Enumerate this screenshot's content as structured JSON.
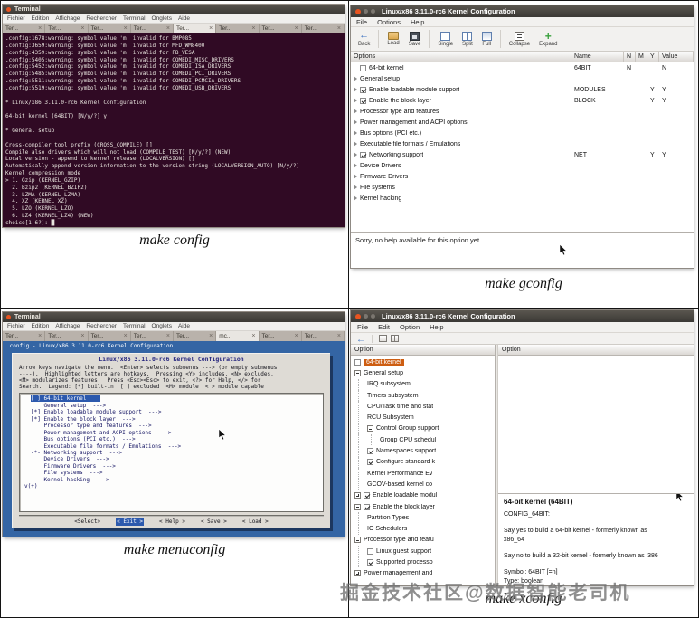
{
  "captions": {
    "tl": "make config",
    "tr": "make gconfig",
    "bl": "make menuconfig",
    "br": "make xconfig"
  },
  "watermark": "掘金技术社区@数据智能老司机",
  "terminal_chrome": {
    "title": "Terminal",
    "menu": [
      "Fichier",
      "Edition",
      "Affichage",
      "Rechercher",
      "Terminal",
      "Onglets",
      "Aide"
    ]
  },
  "config_terminal": {
    "tabs": [
      "Ter...",
      "Ter...",
      "Ter...",
      "Ter...",
      "Ter...",
      "Ter...",
      "Ter...",
      "Ter..."
    ],
    "active_tab": 4,
    "lines": [
      ".config:1678:warning: symbol value 'm' invalid for BMP085",
      ".config:3659:warning: symbol value 'm' invalid for MFD_WM8400",
      ".config:4359:warning: symbol value 'm' invalid for FB_VESA",
      ".config:5405:warning: symbol value 'm' invalid for COMEDI_MISC_DRIVERS",
      ".config:5452:warning: symbol value 'm' invalid for COMEDI_ISA_DRIVERS",
      ".config:5485:warning: symbol value 'm' invalid for COMEDI_PCI_DRIVERS",
      ".config:5511:warning: symbol value 'm' invalid for COMEDI_PCMCIA_DRIVERS",
      ".config:5519:warning: symbol value 'm' invalid for COMEDI_USB_DRIVERS",
      "",
      "* Linux/x86 3.11.0-rc6 Kernel Configuration",
      "",
      "64-bit kernel (64BIT) [N/y/?] y",
      "",
      "* General setup",
      "",
      "Cross-compiler tool prefix (CROSS_COMPILE) []",
      "Compile also drivers which will not load (COMPILE_TEST) [N/y/?] (NEW)",
      "Local version - append to kernel release (LOCALVERSION) []",
      "Automatically append version information to the version string (LOCALVERSION_AUTO) [N/y/?]",
      "Kernel compression mode",
      "> 1. Gzip (KERNEL_GZIP)",
      "  2. Bzip2 (KERNEL_BZIP2)",
      "  3. LZMA (KERNEL_LZMA)",
      "  4. XZ (KERNEL_XZ)",
      "  5. LZO (KERNEL_LZO)",
      "  6. LZ4 (KERNEL_LZ4) (NEW)",
      "choice[1-6?]: █"
    ]
  },
  "menuconfig_terminal": {
    "tabs": [
      "Ter...",
      "Ter...",
      "Ter...",
      "Ter...",
      "Ter...",
      "mc...",
      "Ter...",
      "Ter..."
    ],
    "active_tab": 5,
    "backtitle": ".config - Linux/x86 3.11.0-rc6 Kernel Configuration",
    "dialog_title": "Linux/x86 3.11.0-rc6 Kernel Configuration",
    "instructions": [
      "Arrow keys navigate the menu.  <Enter> selects submenus ---> (or empty submenus",
      "----).  Highlighted letters are hotkeys.  Pressing <Y> includes, <N> excludes,",
      "<M> modularizes features.  Press <Esc><Esc> to exit, <?> for Help, </> for",
      "Search.  Legend: [*] built-in  [ ] excluded  <M> module  < > module capable"
    ],
    "items": [
      {
        "label": "[ ] 64-bit kernel",
        "selected": true
      },
      {
        "label": "    General setup  --->"
      },
      {
        "label": "[*] Enable loadable module support  --->"
      },
      {
        "label": "[*] Enable the block layer  --->"
      },
      {
        "label": "    Processor type and features  --->"
      },
      {
        "label": "    Power management and ACPI options  --->"
      },
      {
        "label": "    Bus options (PCI etc.)  --->"
      },
      {
        "label": "    Executable file formats / Emulations  --->"
      },
      {
        "label": "-*- Networking support  --->"
      },
      {
        "label": "    Device Drivers  --->"
      },
      {
        "label": "    Firmware Drivers  --->"
      },
      {
        "label": "    File systems  --->"
      },
      {
        "label": "    Kernel hacking  --->"
      }
    ],
    "scroll_hint": "v(+)",
    "buttons": [
      {
        "label": "<Select>"
      },
      {
        "label": "< Exit >",
        "selected": true
      },
      {
        "label": "< Help >"
      },
      {
        "label": "< Save >"
      },
      {
        "label": "< Load >"
      }
    ]
  },
  "gconfig": {
    "title": "Linux/x86 3.11.0-rc6 Kernel Configuration",
    "menu": [
      "File",
      "Options",
      "Help"
    ],
    "toolbar": [
      {
        "label": "Back",
        "icon": "back-arrow"
      },
      {
        "sep": true
      },
      {
        "label": "Load",
        "icon": "folder"
      },
      {
        "label": "Save",
        "icon": "disk"
      },
      {
        "sep": true
      },
      {
        "label": "Single",
        "icon": "pane-single"
      },
      {
        "label": "Split",
        "icon": "pane-split"
      },
      {
        "label": "Full",
        "icon": "pane-full"
      },
      {
        "sep": true
      },
      {
        "label": "Collapse",
        "icon": "collapse"
      },
      {
        "label": "Expand",
        "icon": "expand"
      }
    ],
    "columns": [
      "Options",
      "Name",
      "N",
      "M",
      "Y",
      "Value"
    ],
    "rows": [
      {
        "expander": false,
        "checkbox": "unchecked",
        "label": "64-bit kernel",
        "name": "64BIT",
        "n": "N",
        "m": "_",
        "y": "",
        "value": "N"
      },
      {
        "expander": true,
        "label": "General setup"
      },
      {
        "expander": true,
        "checkbox": "checked",
        "label": "Enable loadable module support",
        "name": "MODULES",
        "y": "Y",
        "value": "Y"
      },
      {
        "expander": true,
        "checkbox": "checked",
        "label": "Enable the block layer",
        "name": "BLOCK",
        "y": "Y",
        "value": "Y"
      },
      {
        "expander": true,
        "label": "Processor type and features"
      },
      {
        "expander": true,
        "label": "Power management and ACPI options"
      },
      {
        "expander": true,
        "label": "Bus options (PCI etc.)"
      },
      {
        "expander": true,
        "label": "Executable file formats / Emulations"
      },
      {
        "expander": true,
        "checkbox": "checked",
        "label": "Networking support",
        "name": "NET",
        "y": "Y",
        "value": "Y"
      },
      {
        "expander": true,
        "label": "Device Drivers"
      },
      {
        "expander": true,
        "label": "Firmware Drivers"
      },
      {
        "expander": true,
        "label": "File systems"
      },
      {
        "expander": true,
        "label": "Kernel hacking"
      }
    ],
    "help_text": "Sorry, no help available for this option yet."
  },
  "xconfig": {
    "title": "Linux/x86 3.11.0-rc6 Kernel Configuration",
    "menu": [
      "File",
      "Edit",
      "Option",
      "Help"
    ],
    "left_header": "Option",
    "right_header": "Option",
    "tree": [
      {
        "depth": 0,
        "checkbox": "unchecked",
        "label": "64-bit kernel",
        "selected": true
      },
      {
        "depth": 0,
        "expander": "minus",
        "label": "General setup"
      },
      {
        "depth": 1,
        "label": "IRQ subsystem"
      },
      {
        "depth": 1,
        "label": "Timers subsystem"
      },
      {
        "depth": 1,
        "label": "CPU/Task time and stat"
      },
      {
        "depth": 1,
        "label": "RCU Subsystem"
      },
      {
        "depth": 1,
        "expander": "minus",
        "label": "Control Group support"
      },
      {
        "depth": 2,
        "label": "Group CPU schedul"
      },
      {
        "depth": 1,
        "checkbox": "checked",
        "label": "Namespaces support"
      },
      {
        "depth": 1,
        "checkbox": "checked",
        "label": "Configure standard k"
      },
      {
        "depth": 1,
        "label": "Kernel Performance Ev"
      },
      {
        "depth": 1,
        "label": "GCOV-based kernel co"
      },
      {
        "depth": 0,
        "expander": "plus",
        "checkbox": "checked",
        "label": "Enable loadable modul"
      },
      {
        "depth": 0,
        "expander": "minus",
        "checkbox": "checked",
        "label": "Enable the block layer"
      },
      {
        "depth": 1,
        "label": "Partition Types"
      },
      {
        "depth": 1,
        "label": "IO Schedulers"
      },
      {
        "depth": 0,
        "expander": "minus",
        "label": "Processor type and featu"
      },
      {
        "depth": 1,
        "checkbox": "unchecked",
        "label": "Linux guest support"
      },
      {
        "depth": 1,
        "checkbox": "checked",
        "label": "Supported processo"
      },
      {
        "depth": 0,
        "expander": "plus",
        "label": "Power management and"
      }
    ],
    "help": {
      "title": "64-bit kernel (64BIT)",
      "lines": [
        "CONFIG_64BIT:",
        "",
        "Say yes to build a 64-bit kernel - formerly known as",
        "x86_64",
        "",
        "Say no to build a 32-bit kernel - formerly known as i386",
        "",
        "Symbol: 64BIT [=n]",
        "Type: boolean"
      ]
    }
  }
}
